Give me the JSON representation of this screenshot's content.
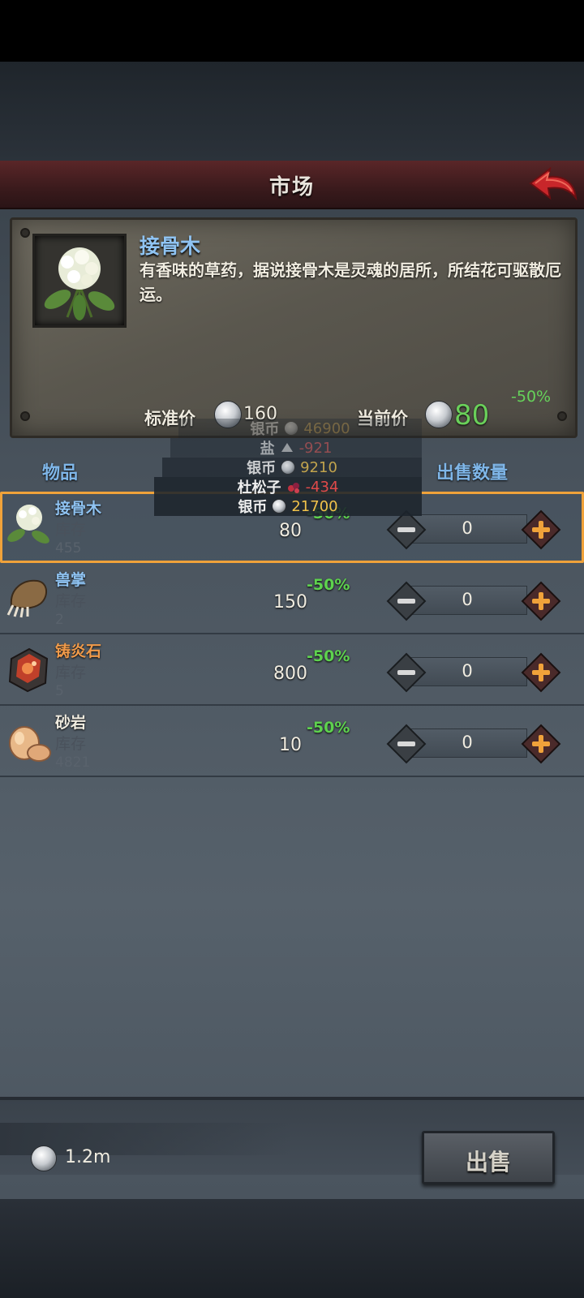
{
  "header": {
    "title": "市场"
  },
  "detail": {
    "name": "接骨木",
    "description": "有香味的草药，据说接骨木是灵魂的居所，所结花可驱散厄运。",
    "discount": "-50%",
    "standard_price_label": "标准价",
    "standard_price": "160",
    "current_price_label": "当前价",
    "current_price": "80"
  },
  "columns": {
    "item": "物品",
    "sell_qty": "出售数量"
  },
  "popup": [
    {
      "label": "银币",
      "value": "46900",
      "icon": "silver-coin-icon",
      "color": "#c9a04a"
    },
    {
      "label": "盐",
      "value": "-921",
      "icon": "salt-icon",
      "color": "#d24a4a"
    },
    {
      "label": "银币",
      "value": "9210",
      "icon": "silver-coin-icon",
      "color": "#e0b84a"
    },
    {
      "label": "杜松子",
      "value": "-434",
      "icon": "juniper-icon",
      "color": "#e04a4a"
    },
    {
      "label": "银币",
      "value": "21700",
      "icon": "silver-coin-icon",
      "color": "#f0c24a"
    }
  ],
  "items": [
    {
      "name": "接骨木",
      "name_color": "#8fc3f2",
      "stock_label": "库存",
      "stock": "455",
      "price": "80",
      "discount": "-50%",
      "qty": "0",
      "icon": "elderflower-icon"
    },
    {
      "name": "兽掌",
      "name_color": "#8fc3f2",
      "stock_label": "库存",
      "stock": "2",
      "price": "150",
      "discount": "-50%",
      "qty": "0",
      "icon": "beast-paw-icon"
    },
    {
      "name": "铸炎石",
      "name_color": "#f09a4a",
      "stock_label": "库存",
      "stock": "5",
      "price": "800",
      "discount": "-50%",
      "qty": "0",
      "icon": "flame-ore-icon"
    },
    {
      "name": "砂岩",
      "name_color": "#f0ece0",
      "stock_label": "库存",
      "stock": "4821",
      "price": "10",
      "discount": "-50%",
      "qty": "0",
      "icon": "sandstone-icon"
    }
  ],
  "footer": {
    "money": "1.2m",
    "sell_label": "出售"
  },
  "colors": {
    "accent_gold": "#f0a23a",
    "discount_green": "#5ed24e",
    "title_red": "#5a2628"
  }
}
